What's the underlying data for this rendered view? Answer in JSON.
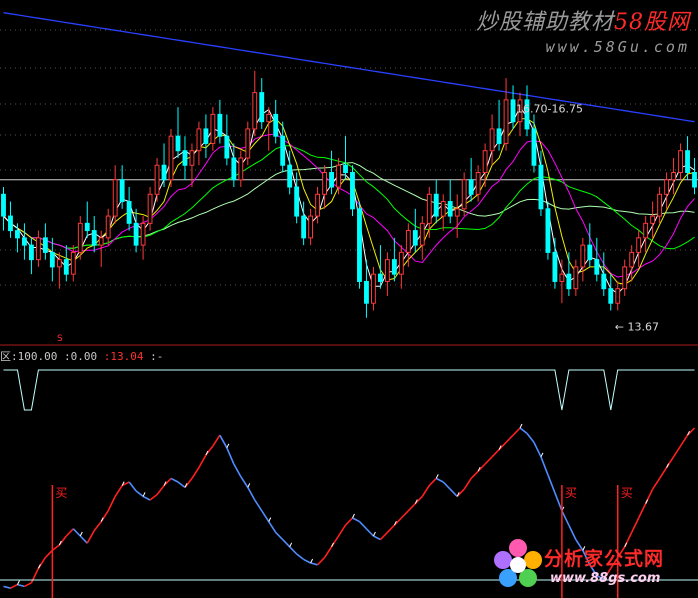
{
  "watermark_top": {
    "prefix": "炒股辅助教材",
    "brand": "58股网",
    "site": "www.58Gu.com"
  },
  "watermark_bottom": {
    "name": "分析家公式网",
    "site": "www.88gs.com"
  },
  "indicator_header": {
    "lead": "区",
    "v1": "100.00",
    "v2": "0.00",
    "v3": "13.04",
    "sep": ":",
    "dash": "-"
  },
  "price_annotations": {
    "high_label": "16.70-16.75",
    "low_label": "13.67"
  },
  "signal_label": "买",
  "chart_data": [
    {
      "type": "candlestick",
      "candles": [
        [
          15.2,
          15.3,
          14.7,
          14.9
        ],
        [
          14.9,
          15.1,
          14.6,
          14.7
        ],
        [
          14.7,
          14.8,
          14.4,
          14.6
        ],
        [
          14.6,
          14.8,
          14.3,
          14.5
        ],
        [
          14.5,
          14.6,
          14.1,
          14.3
        ],
        [
          14.3,
          14.7,
          14.2,
          14.6
        ],
        [
          14.6,
          14.8,
          14.3,
          14.4
        ],
        [
          14.4,
          14.6,
          14.0,
          14.2
        ],
        [
          14.2,
          14.4,
          13.9,
          14.3
        ],
        [
          14.3,
          14.5,
          14.0,
          14.1
        ],
        [
          14.1,
          14.5,
          14.0,
          14.4
        ],
        [
          14.4,
          14.9,
          14.3,
          14.8
        ],
        [
          14.8,
          15.1,
          14.6,
          14.7
        ],
        [
          14.7,
          14.9,
          14.4,
          14.5
        ],
        [
          14.5,
          14.7,
          14.2,
          14.6
        ],
        [
          14.6,
          15.0,
          14.5,
          14.9
        ],
        [
          14.9,
          15.6,
          14.8,
          15.4
        ],
        [
          15.4,
          15.6,
          15.0,
          15.1
        ],
        [
          15.1,
          15.3,
          14.7,
          14.8
        ],
        [
          14.8,
          15.0,
          14.4,
          14.5
        ],
        [
          14.5,
          14.9,
          14.3,
          14.8
        ],
        [
          14.8,
          15.3,
          14.7,
          15.2
        ],
        [
          15.2,
          15.7,
          15.1,
          15.6
        ],
        [
          15.6,
          15.9,
          15.3,
          15.4
        ],
        [
          15.4,
          16.1,
          15.3,
          16.0
        ],
        [
          16.0,
          16.4,
          15.7,
          15.8
        ],
        [
          15.8,
          16.0,
          15.4,
          15.6
        ],
        [
          15.6,
          15.9,
          15.3,
          15.8
        ],
        [
          15.8,
          16.2,
          15.6,
          16.1
        ],
        [
          16.1,
          16.3,
          15.7,
          15.9
        ],
        [
          15.9,
          16.4,
          15.8,
          16.3
        ],
        [
          16.3,
          16.5,
          15.9,
          16.0
        ],
        [
          16.0,
          16.3,
          15.6,
          15.7
        ],
        [
          15.7,
          15.9,
          15.3,
          15.4
        ],
        [
          15.4,
          15.8,
          15.3,
          15.7
        ],
        [
          15.7,
          16.2,
          15.6,
          16.1
        ],
        [
          16.1,
          16.9,
          16.0,
          16.6
        ],
        [
          16.6,
          16.8,
          16.1,
          16.2
        ],
        [
          16.2,
          16.4,
          15.8,
          16.3
        ],
        [
          16.3,
          16.5,
          15.9,
          16.0
        ],
        [
          16.0,
          16.2,
          15.5,
          15.6
        ],
        [
          15.6,
          15.8,
          15.2,
          15.3
        ],
        [
          15.3,
          15.5,
          14.8,
          14.9
        ],
        [
          14.9,
          15.1,
          14.5,
          14.6
        ],
        [
          14.6,
          15.0,
          14.5,
          14.9
        ],
        [
          14.9,
          15.3,
          14.8,
          15.2
        ],
        [
          15.2,
          15.6,
          15.0,
          15.5
        ],
        [
          15.5,
          15.8,
          15.2,
          15.3
        ],
        [
          15.3,
          15.7,
          15.2,
          15.6
        ],
        [
          15.6,
          16.0,
          15.4,
          15.5
        ],
        [
          15.5,
          15.6,
          14.9,
          15.0
        ],
        [
          15.0,
          15.1,
          13.9,
          14.0
        ],
        [
          14.0,
          14.3,
          13.5,
          13.7
        ],
        [
          13.7,
          14.2,
          13.6,
          14.1
        ],
        [
          14.1,
          14.5,
          13.9,
          14.0
        ],
        [
          14.0,
          14.4,
          13.8,
          14.3
        ],
        [
          14.3,
          14.6,
          14.0,
          14.1
        ],
        [
          14.1,
          14.5,
          13.9,
          14.4
        ],
        [
          14.4,
          14.8,
          14.2,
          14.7
        ],
        [
          14.7,
          15.0,
          14.4,
          14.5
        ],
        [
          14.5,
          14.9,
          14.3,
          14.8
        ],
        [
          14.8,
          15.3,
          14.6,
          15.2
        ],
        [
          15.2,
          15.4,
          14.8,
          14.9
        ],
        [
          14.9,
          15.2,
          14.7,
          15.1
        ],
        [
          15.1,
          15.4,
          14.8,
          14.9
        ],
        [
          14.9,
          15.2,
          14.6,
          15.0
        ],
        [
          15.0,
          15.5,
          14.9,
          15.4
        ],
        [
          15.4,
          15.7,
          15.1,
          15.2
        ],
        [
          15.2,
          15.6,
          15.1,
          15.5
        ],
        [
          15.5,
          15.9,
          15.3,
          15.8
        ],
        [
          15.8,
          16.3,
          15.6,
          16.1
        ],
        [
          16.1,
          16.5,
          15.8,
          15.9
        ],
        [
          15.9,
          16.8,
          15.8,
          16.5
        ],
        [
          16.5,
          16.7,
          16.1,
          16.2
        ],
        [
          16.2,
          16.6,
          16.0,
          16.5
        ],
        [
          16.5,
          16.7,
          16.0,
          16.1
        ],
        [
          16.1,
          16.3,
          15.5,
          15.6
        ],
        [
          15.6,
          15.8,
          14.9,
          15.0
        ],
        [
          15.0,
          15.1,
          14.3,
          14.4
        ],
        [
          14.4,
          14.6,
          13.9,
          14.0
        ],
        [
          14.0,
          14.3,
          13.7,
          14.1
        ],
        [
          14.1,
          14.4,
          13.8,
          13.9
        ],
        [
          13.9,
          14.3,
          13.8,
          14.2
        ],
        [
          14.2,
          14.6,
          14.0,
          14.5
        ],
        [
          14.5,
          14.8,
          14.2,
          14.3
        ],
        [
          14.3,
          14.6,
          14.0,
          14.1
        ],
        [
          14.1,
          14.4,
          13.8,
          13.9
        ],
        [
          13.9,
          14.1,
          13.6,
          13.7
        ],
        [
          13.7,
          14.0,
          13.6,
          13.9
        ],
        [
          13.9,
          14.3,
          13.8,
          14.2
        ],
        [
          14.2,
          14.5,
          14.0,
          14.4
        ],
        [
          14.4,
          14.7,
          14.2,
          14.6
        ],
        [
          14.6,
          14.9,
          14.4,
          14.8
        ],
        [
          14.8,
          15.1,
          14.6,
          14.9
        ],
        [
          14.9,
          15.3,
          14.8,
          15.2
        ],
        [
          15.2,
          15.5,
          15.0,
          15.4
        ],
        [
          15.4,
          15.7,
          15.2,
          15.5
        ],
        [
          15.5,
          15.9,
          15.4,
          15.8
        ],
        [
          15.8,
          16.0,
          15.4,
          15.5
        ],
        [
          15.5,
          15.7,
          15.2,
          15.3
        ]
      ],
      "y_range": [
        13.4,
        17.6
      ],
      "reference_level": 15.4,
      "ma_long_start": 17.7,
      "ma_long_end": 16.2
    },
    {
      "type": "line",
      "name": "indicator",
      "ylim": [
        0,
        100
      ],
      "values": [
        2,
        1,
        3,
        2,
        4,
        12,
        18,
        22,
        25,
        30,
        34,
        30,
        26,
        33,
        38,
        44,
        52,
        58,
        60,
        55,
        52,
        50,
        53,
        58,
        62,
        60,
        57,
        62,
        68,
        75,
        80,
        86,
        79,
        70,
        63,
        57,
        50,
        44,
        38,
        32,
        28,
        24,
        20,
        17,
        15,
        14,
        18,
        24,
        30,
        36,
        40,
        38,
        34,
        30,
        28,
        32,
        36,
        40,
        44,
        48,
        52,
        58,
        62,
        60,
        56,
        52,
        56,
        62,
        66,
        70,
        74,
        78,
        82,
        86,
        90,
        87,
        82,
        74,
        64,
        54,
        44,
        36,
        28,
        22,
        14,
        8,
        6,
        12,
        18,
        24,
        32,
        40,
        48,
        56,
        62,
        68,
        74,
        80,
        86,
        90
      ],
      "colors": {
        "up": "#ff2020",
        "down": "#4f8cff",
        "base": "#ffffff"
      }
    }
  ],
  "colors": {
    "candle_up": "#ff3a3a",
    "candle_down": "#00ffff",
    "ma_white": "#ffffff",
    "ma_yellow": "#f0f000",
    "ma_magenta": "#ff00ff",
    "ma_green": "#00ff00",
    "ma_slow": "#b0ffb0",
    "ma_long": "#2a40ff",
    "grid": "#555555"
  }
}
